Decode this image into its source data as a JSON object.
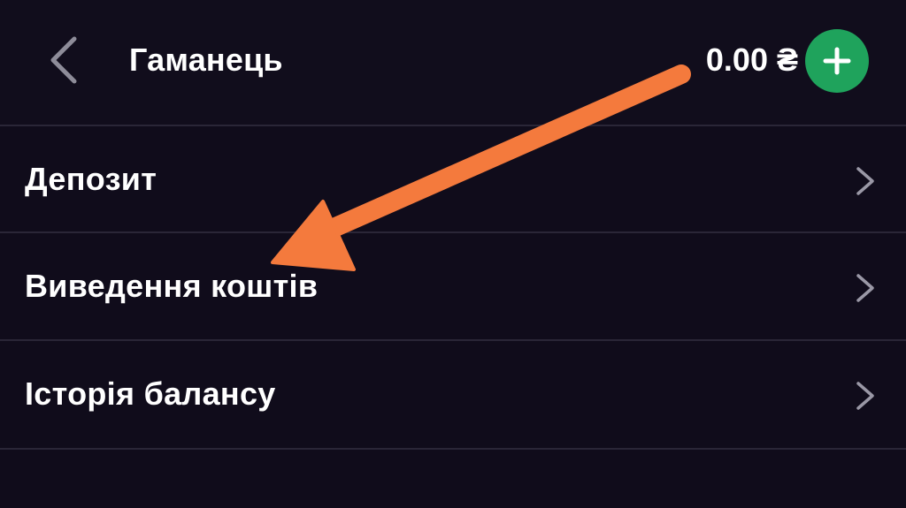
{
  "header": {
    "title": "Гаманець",
    "balance": "0.00 ₴",
    "back_icon": "chevron-left-icon",
    "add_icon": "plus-icon",
    "add_color": "#1fa35c"
  },
  "menu": {
    "items": [
      {
        "label": "Депозит"
      },
      {
        "label": "Виведення коштів"
      },
      {
        "label": "Історія балансу"
      }
    ],
    "chevron_icon": "chevron-right-icon"
  },
  "annotation": {
    "arrow_color": "#f47a3d",
    "points_to": "Виведення коштів"
  },
  "colors": {
    "background": "#100c1b",
    "divider": "#2a2637",
    "text": "#ffffff",
    "chevron": "#9a98a6"
  }
}
